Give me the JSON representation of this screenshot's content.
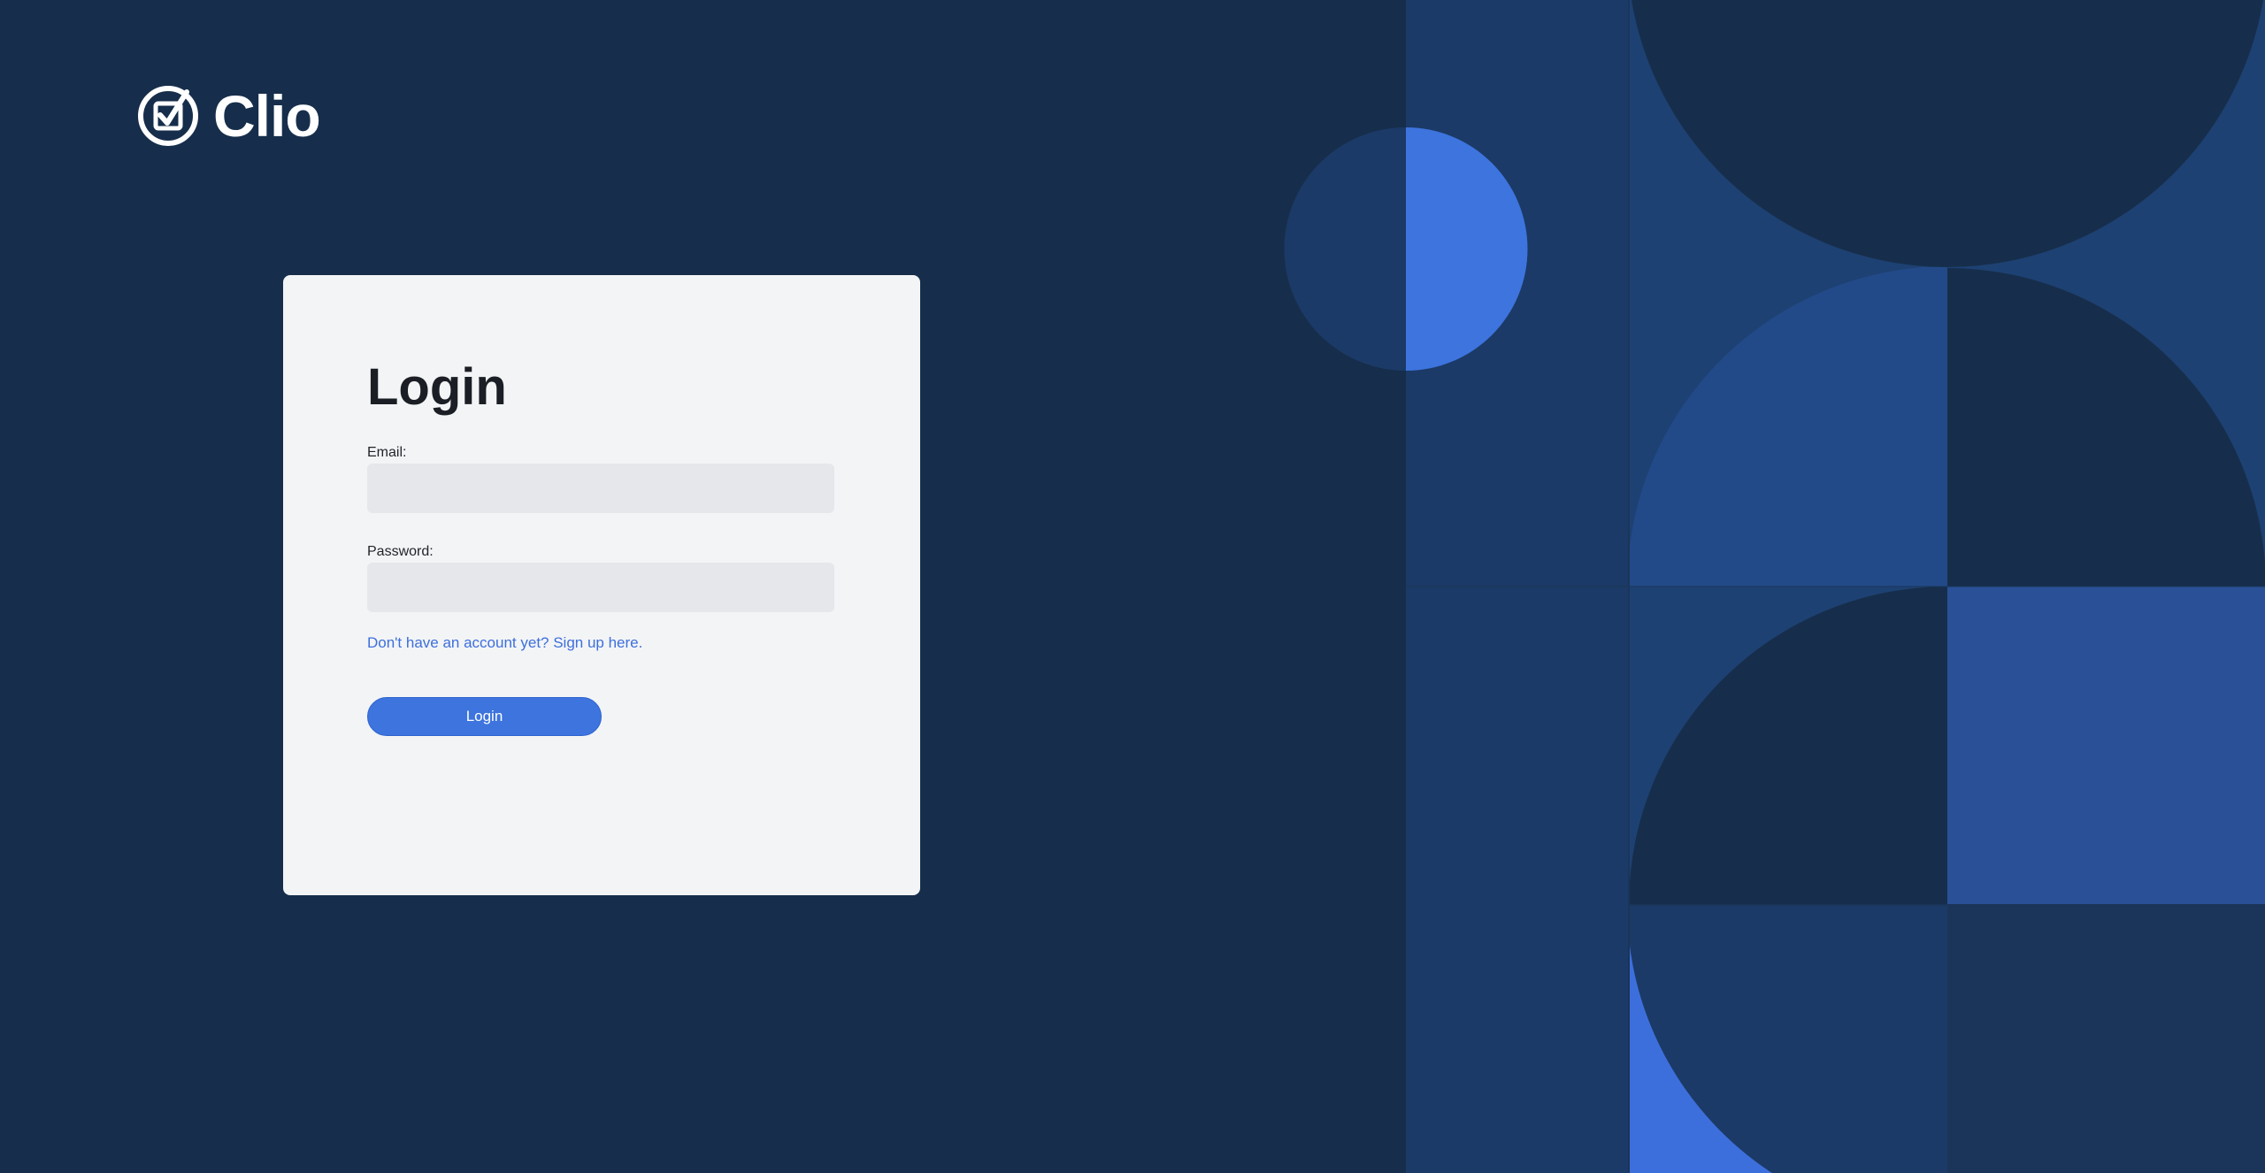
{
  "brand": {
    "name": "Clio",
    "logo_icon": "checkbox-check-icon"
  },
  "login": {
    "title": "Login",
    "email_label": "Email:",
    "email_value": "",
    "password_label": "Password:",
    "password_value": "",
    "signup_link": "Don't have an account yet? Sign up here.",
    "submit_label": "Login"
  },
  "colors": {
    "background": "#162e4b",
    "card": "#f3f4f6",
    "accent": "#3d74de",
    "link": "#3d6fdc",
    "input_fill": "#e5e7eb"
  }
}
